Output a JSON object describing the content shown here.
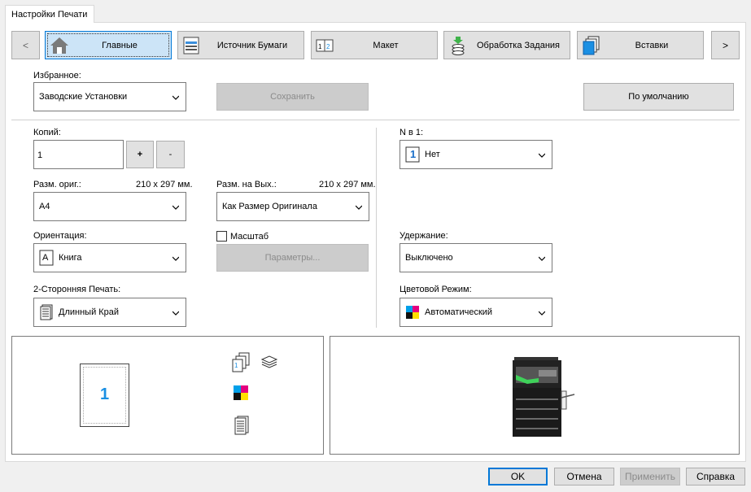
{
  "tab": {
    "title": "Настройки Печати"
  },
  "nav": {
    "prev": "<",
    "next": ">",
    "items": [
      {
        "label": "Главные",
        "icon": "home-icon"
      },
      {
        "label": "Источник Бумаги",
        "icon": "paper-source-icon"
      },
      {
        "label": "Макет",
        "icon": "layout-icon"
      },
      {
        "label": "Обработка Задания",
        "icon": "job-processing-icon"
      },
      {
        "label": "Вставки",
        "icon": "insert-pages-icon"
      }
    ]
  },
  "favorites": {
    "label": "Избранное:",
    "value": "Заводские Установки",
    "save": "Сохранить",
    "default": "По умолчанию"
  },
  "copies": {
    "label": "Копий:",
    "value": "1",
    "plus": "+",
    "minus": "-"
  },
  "orig_size": {
    "label": "Разм. ориг.:",
    "dims": "210 x 297 мм.",
    "value": "A4"
  },
  "out_size": {
    "label": "Разм. на Вых.:",
    "dims": "210 x 297 мм.",
    "value": "Как Размер Оригинала"
  },
  "orientation": {
    "label": "Ориентация:",
    "value": "Книга",
    "icon_letter": "A"
  },
  "scale": {
    "label": "Масштаб",
    "checked": false,
    "params": "Параметры..."
  },
  "duplex": {
    "label": "2-Сторонняя Печать:",
    "value": "Длинный Край"
  },
  "nup": {
    "label": "N в 1:",
    "value": "Нет",
    "icon_digit": "1"
  },
  "hold": {
    "label": "Удержание:",
    "value": "Выключено"
  },
  "color_mode": {
    "label": "Цветовой Режим:",
    "value": "Автоматический"
  },
  "preview": {
    "page_number": "1"
  },
  "footer": {
    "ok": "OK",
    "cancel": "Отмена",
    "apply": "Применить",
    "help": "Справка"
  },
  "colors": {
    "accent": "#0078d7",
    "page_number": "#1a8fe3",
    "printer_green": "#3fd15a"
  }
}
